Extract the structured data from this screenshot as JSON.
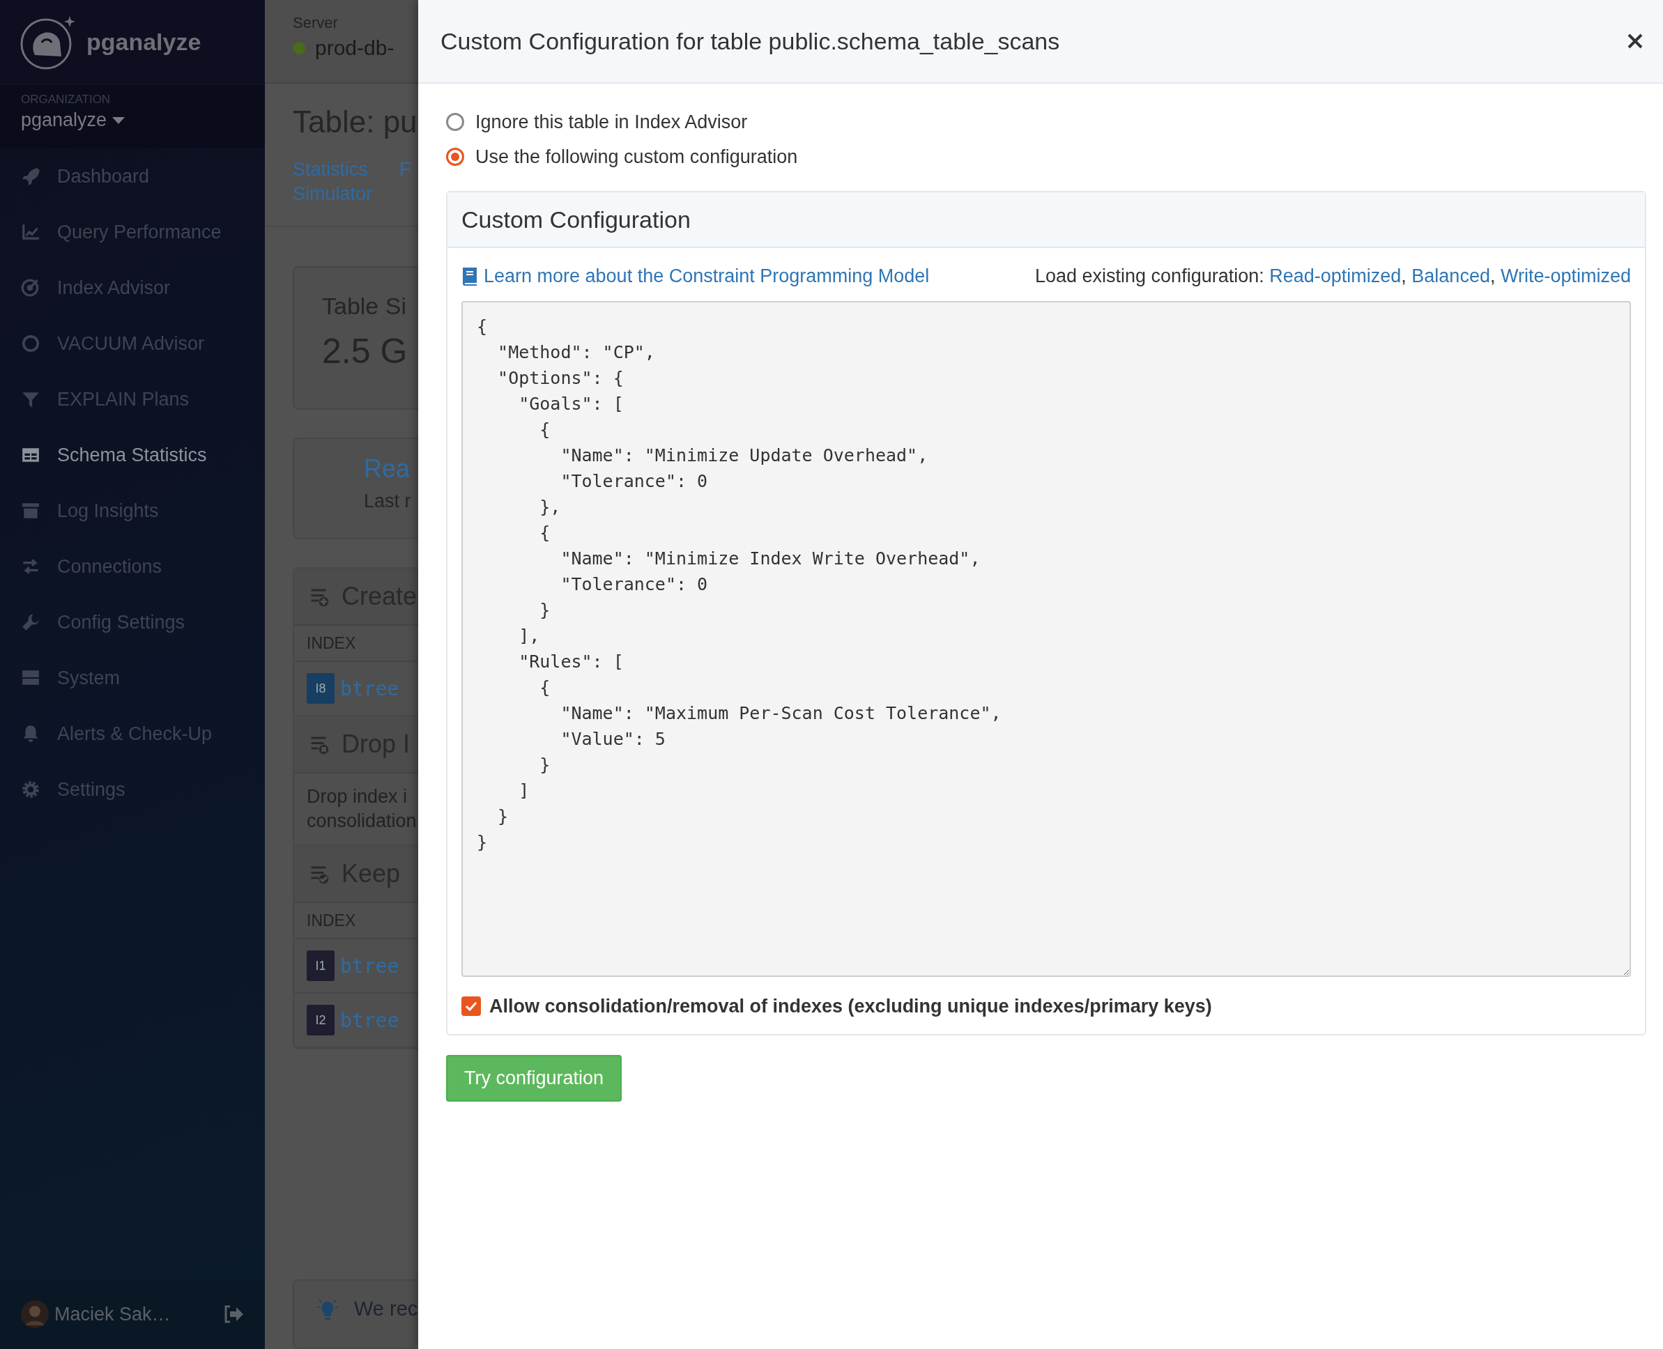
{
  "sidebar": {
    "brand": "pganalyze",
    "organization_label": "ORGANIZATION",
    "organization": "pganalyze",
    "items": [
      {
        "label": "Dashboard",
        "kind": "rocket",
        "selected": false
      },
      {
        "label": "Query Performance",
        "kind": "chart",
        "selected": false
      },
      {
        "label": "Index Advisor",
        "kind": "target",
        "selected": false
      },
      {
        "label": "VACUUM Advisor",
        "kind": "ring",
        "selected": false
      },
      {
        "label": "EXPLAIN Plans",
        "kind": "funnel",
        "selected": false
      },
      {
        "label": "Schema Statistics",
        "kind": "table",
        "selected": true
      },
      {
        "label": "Log Insights",
        "kind": "archive",
        "selected": false
      },
      {
        "label": "Connections",
        "kind": "arrows",
        "selected": false
      },
      {
        "label": "Config Settings",
        "kind": "wrench",
        "selected": false
      },
      {
        "label": "System",
        "kind": "server",
        "selected": false
      },
      {
        "label": "Alerts & Check-Up",
        "kind": "bell",
        "selected": false
      },
      {
        "label": "Settings",
        "kind": "gear",
        "selected": false
      }
    ],
    "user": {
      "name": "Maciek Sak…"
    }
  },
  "background": {
    "server_label": "Server",
    "server_name": "prod-db-",
    "title": "Table: pu",
    "tabs": [
      {
        "label": "Statistics"
      },
      {
        "label": "F"
      },
      {
        "label": "Simulator"
      }
    ],
    "size_card": {
      "title": "Table Si",
      "value": "2.5 G"
    },
    "run_card": {
      "title": "Rea",
      "subtitle": "Last r"
    },
    "sections": [
      {
        "kind": "create",
        "title": "Create",
        "column": "INDEX",
        "rows": [
          {
            "badge": "I8",
            "color": "#173e63",
            "text": "btree"
          }
        ]
      },
      {
        "kind": "drop",
        "title": "Drop I",
        "lines": [
          "Drop index i",
          "consolidation"
        ]
      },
      {
        "kind": "keep",
        "title": "Keep",
        "column": "INDEX",
        "rows": [
          {
            "badge": "I1",
            "color": "#1f1d30",
            "text": "btree"
          },
          {
            "badge": "I2",
            "color": "#1f1d30",
            "text": "btree"
          }
        ]
      }
    ],
    "tip": {
      "text": "We rec"
    }
  },
  "dialog": {
    "title": "Custom Configuration for table public.schema_table_scans",
    "radios": [
      {
        "label": "Ignore this table in Index Advisor",
        "selected": false
      },
      {
        "label": "Use the following custom configuration",
        "selected": true
      }
    ],
    "panel": {
      "title": "Custom Configuration",
      "learn_link": "Learn more about the Constraint Programming Model",
      "load": {
        "label": "Load existing configuration: ",
        "link_1": "Read-optimized",
        "separator_1": ", ",
        "link_2": "Balanced",
        "separator_2": ", ",
        "link_3": "Write-optimized"
      },
      "config": "{\n  \"Method\": \"CP\",\n  \"Options\": {\n    \"Goals\": [\n      {\n        \"Name\": \"Minimize Update Overhead\",\n        \"Tolerance\": 0\n      },\n      {\n        \"Name\": \"Minimize Index Write Overhead\",\n        \"Tolerance\": 0\n      }\n    ],\n    \"Rules\": [\n      {\n        \"Name\": \"Maximum Per-Scan Cost Tolerance\",\n        \"Value\": 5\n      }\n    ]\n  }\n}",
      "checkbox": {
        "label": "Allow consolidation/removal of indexes (excluding unique indexes/primary keys)",
        "checked": true
      }
    },
    "button": "Try configuration"
  }
}
